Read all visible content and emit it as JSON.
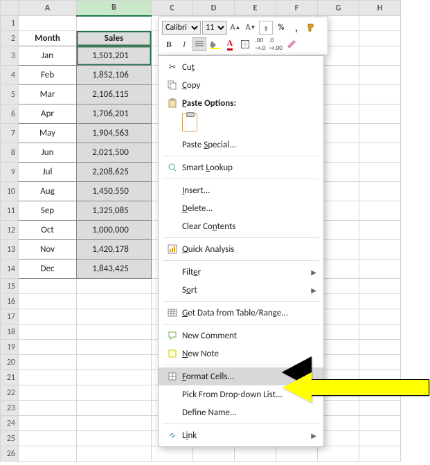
{
  "columns": [
    "A",
    "B",
    "C",
    "D",
    "E",
    "F",
    "G",
    "H"
  ],
  "selected_col": "B",
  "headers": {
    "a": "Month",
    "b": "Sales"
  },
  "rows": [
    {
      "m": "Jan",
      "v": "1,501,201"
    },
    {
      "m": "Feb",
      "v": "1,852,106"
    },
    {
      "m": "Mar",
      "v": "2,106,115"
    },
    {
      "m": "Apr",
      "v": "1,706,201"
    },
    {
      "m": "May",
      "v": "1,904,563"
    },
    {
      "m": "Jun",
      "v": "2,021,500"
    },
    {
      "m": "Jul",
      "v": "2,208,625"
    },
    {
      "m": "Aug",
      "v": "1,450,550"
    },
    {
      "m": "Sep",
      "v": "1,325,085"
    },
    {
      "m": "Oct",
      "v": "1,000,000"
    },
    {
      "m": "Nov",
      "v": "1,420,178"
    },
    {
      "m": "Dec",
      "v": "1,843,425"
    }
  ],
  "total_rows": 26,
  "minitoolbar": {
    "font": "Calibri",
    "size": "11",
    "bold": "B",
    "italic": "I"
  },
  "menu": {
    "cut": "Cut",
    "copy": "Copy",
    "paste_options": "Paste Options:",
    "paste_special": "Paste Special...",
    "smart_lookup": "Smart Lookup",
    "insert": "Insert...",
    "delete": "Delete...",
    "clear_contents": "Clear Contents",
    "quick_analysis": "Quick Analysis",
    "filter": "Filter",
    "sort": "Sort",
    "get_data": "Get Data from Table/Range...",
    "new_comment": "New Comment",
    "new_note": "New Note",
    "format_cells": "Format Cells...",
    "pick_list": "Pick From Drop-down List...",
    "define_name": "Define Name...",
    "link": "Link",
    "u": {
      "cut": "t",
      "copy": "C",
      "paste_options": "P",
      "paste_special": "S",
      "smart_lookup": "L",
      "insert": "I",
      "delete": "D",
      "clear_contents": "n",
      "quick_analysis": "Q",
      "filter": "e",
      "sort": "o",
      "get_data": "G",
      "new_comment": "M",
      "new_note": "N",
      "format_cells": "F",
      "pick_list": "K",
      "define_name": "A",
      "link": "i"
    }
  }
}
